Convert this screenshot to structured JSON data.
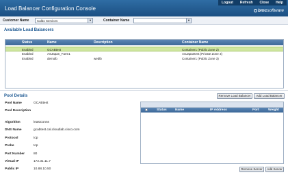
{
  "header": {
    "title": "Load Balancer Configuration Console",
    "nav": [
      "Logout",
      "Refresh",
      "Close",
      "Help"
    ],
    "brand": "bmc",
    "brand_suffix": "software"
  },
  "selectors": {
    "customer_label": "Customer Name",
    "customer_value": "Calbo Services",
    "container_label": "Container Name",
    "container_value": ""
  },
  "load_balancers": {
    "title": "Available Load Balancers",
    "columns": [
      "Status",
      "Name",
      "Description",
      "Container Name"
    ],
    "rows": [
      [
        "Enabled",
        "GCABtest",
        "",
        "Container1 (Public Zone 2)"
      ],
      [
        "Enabled",
        "ASJapan_Farm1",
        "",
        "ASJapantest (Private Zone 3)"
      ],
      [
        "Enabled",
        "demolb",
        "weblb",
        "Container1 (Public Zone 3)"
      ]
    ],
    "remove_label": "Remove Load Balancer",
    "add_label": "Add Load Balancer"
  },
  "pool": {
    "title": "Pool Details",
    "fields": [
      {
        "label": "Pool Name",
        "value": "GCABtest"
      },
      {
        "label": "Pool Description",
        "value": ""
      },
      {
        "label": "Algorithm",
        "value": "leastconns"
      },
      {
        "label": "DNS Name",
        "value": "gcabtest.cal.cloudlab.cisco.com"
      },
      {
        "label": "Protocol",
        "value": "tcp"
      },
      {
        "label": "Probe",
        "value": "tcp"
      },
      {
        "label": "Port Number",
        "value": "80"
      },
      {
        "label": "Virtual IP",
        "value": "172.31.11.7"
      },
      {
        "label": "Public IP",
        "value": "10.88.10.50"
      }
    ]
  },
  "servers": {
    "columns": [
      "Status",
      "Name",
      "IP Address",
      "Port",
      "Weight"
    ],
    "remove_label": "Remove Server",
    "add_label": "Add Server"
  }
}
